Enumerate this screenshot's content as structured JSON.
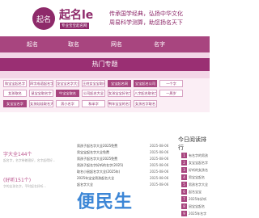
{
  "header": {
    "logo_text": "起名",
    "brand": "起名le",
    "brand_sub": "专业宝宝起名网",
    "slogan1": "传承国学经典，弘扬中华文化",
    "slogan2": "周易科学测算，助您扬名天下"
  },
  "nav": [
    "起名",
    "取名",
    "网名",
    "名字"
  ],
  "hot": {
    "title": "热门专题"
  },
  "tags": [
    "和宝宝起名字",
    "四字成语起名字",
    "龙宝宝名字大全",
    "王姓女宝宝取名",
    "宝宝起名网",
    "宝宝起名公司",
    "一个字",
    "女孩取名",
    "鼠宝宝取名字",
    "牛宝宝取名",
    "公司起名大全",
    "女孩宝宝好名字",
    "八字起名取名字",
    "一周岁",
    "女宝宝名字",
    "女孩娃娃取名大全",
    "男小名字",
    "和半字",
    "鸭年宝宝的名字",
    "女孩名字取名"
  ],
  "sections": {
    "left_title1": "字大全144个",
    "left_title2": "(好听151个)",
    "left_body1": "起名字，名字带着很好，名字起得好...",
    "left_body2": "字的女孩名字，平时起名好听..."
  },
  "news": [
    {
      "t": "男孩子起名字大全2025免费",
      "d": "2025-08-06"
    },
    {
      "t": "男宝宝起名字大全免费",
      "d": "2025-08-06"
    },
    {
      "t": "男孩子起名字大全2025免费",
      "d": "2025-08-06"
    },
    {
      "t": "男孩子起名字好听的名字(2025)",
      "d": "2025-08-06"
    },
    {
      "t": "取名小鼠起名字大全(2025年)",
      "d": "2025-08-06"
    },
    {
      "t": "2025年宝宝男孩起名大全",
      "d": "2025-08-06"
    },
    {
      "t": "起名字大全",
      "d": "2025-08-06"
    }
  ],
  "side": {
    "title": "今日阅读排行",
    "items": [
      "有名字的男孩",
      "女宝宝起名字",
      "好听的女孩名",
      "男宝宝起名",
      "男孩名字大全",
      "起名宝宝",
      "2025年好听",
      "鼠宝宝起名",
      "2025年名字"
    ]
  },
  "watermark": "便民生"
}
